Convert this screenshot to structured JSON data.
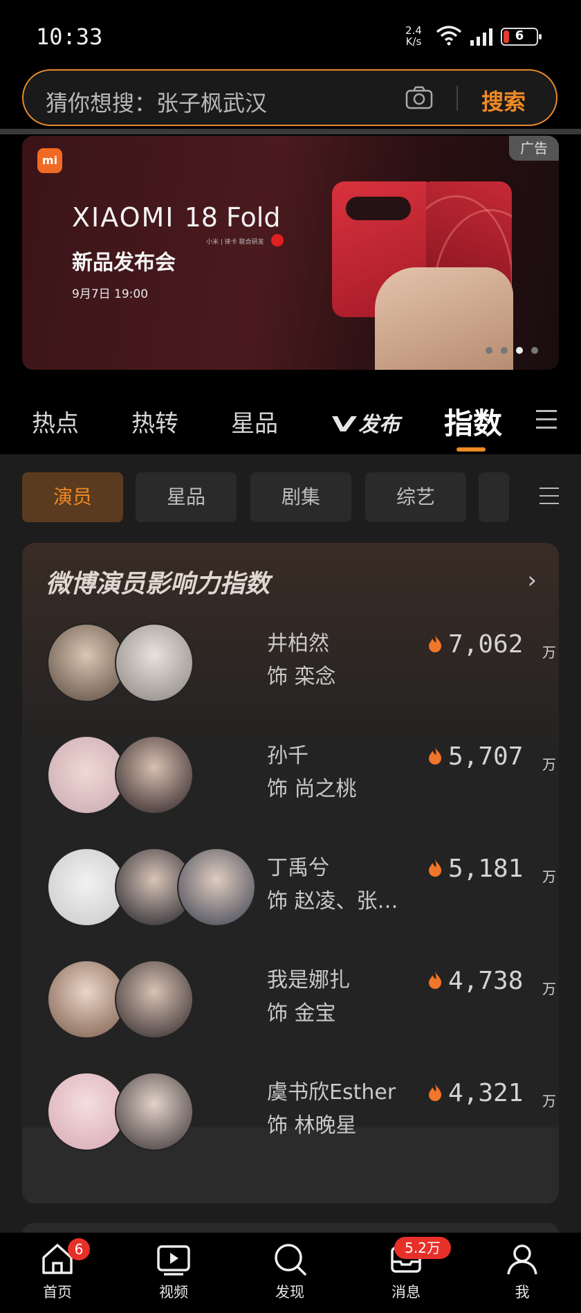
{
  "status_bar": {
    "time": "10:33",
    "net_speed": "2.4",
    "net_unit": "K/s",
    "battery": "6",
    "icons": [
      "wifi-icon",
      "signal-icon",
      "battery-icon"
    ]
  },
  "search": {
    "placeholder": "猜你想搜：张子枫武汉",
    "button": "搜索",
    "icons": [
      "camera-icon"
    ]
  },
  "banner": {
    "ad_tag": "广告",
    "logo": "mi",
    "brand": "XIAOMI",
    "model": "18 Fold",
    "co_brand": "小米 | 徕卡 联合研发",
    "title": "新品发布会",
    "date": "9月7日 19:00",
    "page_indicator": {
      "count": 4,
      "active": 3
    }
  },
  "top_tabs": {
    "items": [
      {
        "label": "热点"
      },
      {
        "label": "热转"
      },
      {
        "label": "星品"
      },
      {
        "label": "发布"
      },
      {
        "label": "指数"
      }
    ],
    "active": "指数"
  },
  "sub_tabs": {
    "items": [
      {
        "label": "演员"
      },
      {
        "label": "星品"
      },
      {
        "label": "剧集"
      },
      {
        "label": "综艺"
      }
    ],
    "active": "演员"
  },
  "card": {
    "title": "微博演员影响力指数",
    "unit": "万",
    "rows": [
      {
        "name": "井柏然",
        "role": "饰 栾念",
        "score": "7,062"
      },
      {
        "name": "孙千",
        "role": "饰 尚之桃",
        "score": "5,707"
      },
      {
        "name": "丁禹兮",
        "role": "饰 赵凌、张…",
        "score": "5,181"
      },
      {
        "name": "我是娜扎",
        "role": "饰 金宝",
        "score": "4,738"
      },
      {
        "name": "虞书欣Esther",
        "role": "饰 林晚星",
        "score": "4,321"
      }
    ]
  },
  "bottom_nav": {
    "items": [
      {
        "label": "首页",
        "badge": "6"
      },
      {
        "label": "视频"
      },
      {
        "label": "发现"
      },
      {
        "label": "消息",
        "badge": "5.2万"
      },
      {
        "label": "我"
      }
    ]
  },
  "colors": {
    "accent": "#f08a24",
    "background": "#000000",
    "panel": "#1d1d1d",
    "badge": "#e8302a"
  }
}
